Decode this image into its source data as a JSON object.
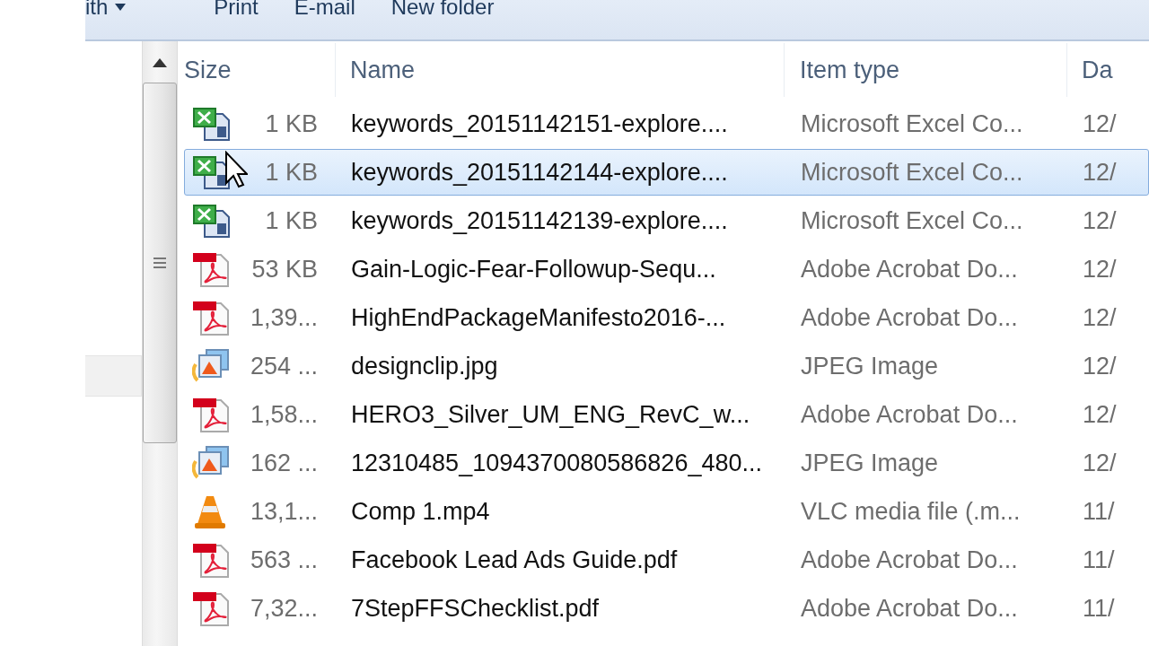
{
  "toolbar": [
    {
      "label": "ith",
      "caret": true
    },
    {
      "label": "Print",
      "caret": false
    },
    {
      "label": "E-mail",
      "caret": false
    },
    {
      "label": "New folder",
      "caret": false
    }
  ],
  "columns": [
    "Size",
    "Name",
    "Item type",
    "Da"
  ],
  "rows": [
    {
      "kind": "excel",
      "size": "1 KB",
      "name": "keywords_20151142151-explore....",
      "type": "Microsoft Excel Co...",
      "date": "12/",
      "selected": false
    },
    {
      "kind": "excel",
      "size": "1 KB",
      "name": "keywords_20151142144-explore....",
      "type": "Microsoft Excel Co...",
      "date": "12/",
      "selected": true
    },
    {
      "kind": "excel",
      "size": "1 KB",
      "name": "keywords_20151142139-explore....",
      "type": "Microsoft Excel Co...",
      "date": "12/",
      "selected": false
    },
    {
      "kind": "pdf",
      "size": "53 KB",
      "name": "Gain-Logic-Fear-Followup-Sequ...",
      "type": "Adobe Acrobat Do...",
      "date": "12/",
      "selected": false
    },
    {
      "kind": "pdf",
      "size": "1,39...",
      "name": "HighEndPackageManifesto2016-...",
      "type": "Adobe Acrobat Do...",
      "date": "12/",
      "selected": false
    },
    {
      "kind": "image",
      "size": "254 ...",
      "name": "designclip.jpg",
      "type": "JPEG Image",
      "date": "12/",
      "selected": false
    },
    {
      "kind": "pdf",
      "size": "1,58...",
      "name": "HERO3_Silver_UM_ENG_RevC_w...",
      "type": "Adobe Acrobat Do...",
      "date": "12/",
      "selected": false
    },
    {
      "kind": "image",
      "size": "162 ...",
      "name": "12310485_1094370080586826_480...",
      "type": "JPEG Image",
      "date": "12/",
      "selected": false
    },
    {
      "kind": "vlc",
      "size": "13,1...",
      "name": "Comp 1.mp4",
      "type": "VLC media file (.m...",
      "date": "11/",
      "selected": false
    },
    {
      "kind": "pdf",
      "size": "563 ...",
      "name": "Facebook Lead Ads Guide.pdf",
      "type": "Adobe Acrobat Do...",
      "date": "11/",
      "selected": false
    },
    {
      "kind": "pdf",
      "size": "7,32...",
      "name": "7StepFFSChecklist.pdf",
      "type": "Adobe Acrobat Do...",
      "date": "11/",
      "selected": false
    }
  ]
}
